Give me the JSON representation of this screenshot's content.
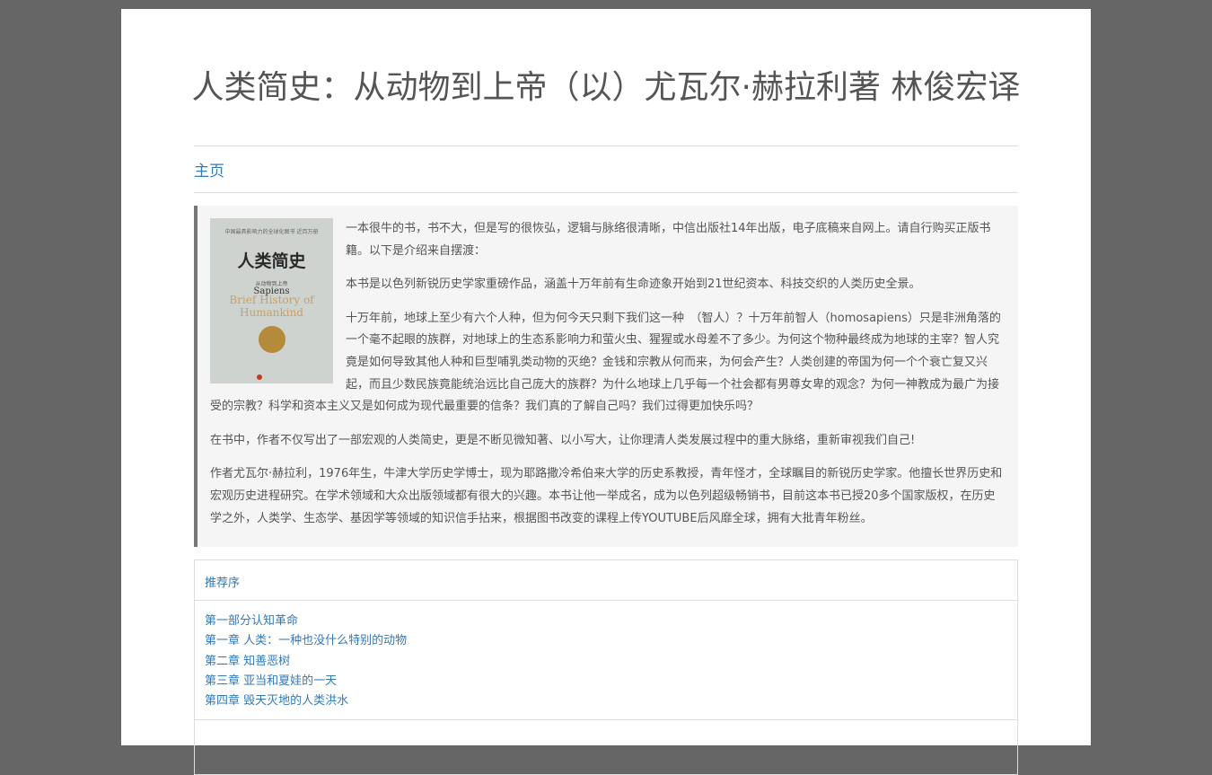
{
  "page_title": "人类简史：从动物到上帝（以）尤瓦尔·赫拉利著 林俊宏译",
  "nav": {
    "home_label": "主页"
  },
  "cover": {
    "top_text": "中国最具影响力的全球化图书\n近百万册",
    "title": "人类简史",
    "subtitle": "从动物到上帝",
    "sapiens": "Sapiens",
    "english_title": "Brief History of Humankind"
  },
  "intro": {
    "paragraphs": [
      "一本很牛的书，书不大，但是写的很恢弘，逻辑与脉络很清晰，中信出版社14年出版，电子底稿来自网上。请自行购买正版书籍。以下是介绍来自摆渡：",
      "本书是以色列新锐历史学家重磅作品，涵盖十万年前有生命迹象开始到21世纪资本、科技交织的人类历史全景。",
      "十万年前，地球上至少有六个人种，但为何今天只剩下我们这一种　（智人）？十万年前智人（homosapiens）只是非洲角落的一个毫不起眼的族群，对地球上的生态系影响力和萤火虫、猩猩或水母差不了多少。为何这个物种最终成为地球的主宰？智人究竟是如何导致其他人种和巨型哺乳类动物的灭绝？金钱和宗教从何而来，为何会产生？人类创建的帝国为何一个个衰亡复又兴起，而且少数民族竟能统治远比自己庞大的族群？为什么地球上几乎每一个社会都有男尊女卑的观念？为何一神教成为最广为接受的宗教？科学和资本主义又是如何成为现代最重要的信条？我们真的了解自己吗？我们过得更加快乐吗？",
      "在书中，作者不仅写出了一部宏观的人类简史，更是不断见微知著、以小写大，让你理清人类发展过程中的重大脉络，重新审视我们自己!",
      "作者尤瓦尔·赫拉利，1976年生，牛津大学历史学博士，现为耶路撒冷希伯来大学的历史系教授，青年怪才，全球瞩目的新锐历史学家。他擅长世界历史和宏观历史进程研究。在学术领域和大众出版领域都有很大的兴趣。本书让他一举成名，成为以色列超级畅销书，目前这本书已授20多个国家版权，在历史学之外，人类学、生态学、基因学等领域的知识信手拈来，根据图书改变的课程上传YOUTUBE后风靡全球，拥有大批青年粉丝。"
    ]
  },
  "toc": {
    "header": "推荐序",
    "items": [
      "第一部分认知革命",
      "第一章 人类：一种也没什么特别的动物",
      "第二章 知善恶树",
      "第三章 亚当和夏娃的一天",
      "第四章 毁天灭地的人类洪水"
    ]
  }
}
